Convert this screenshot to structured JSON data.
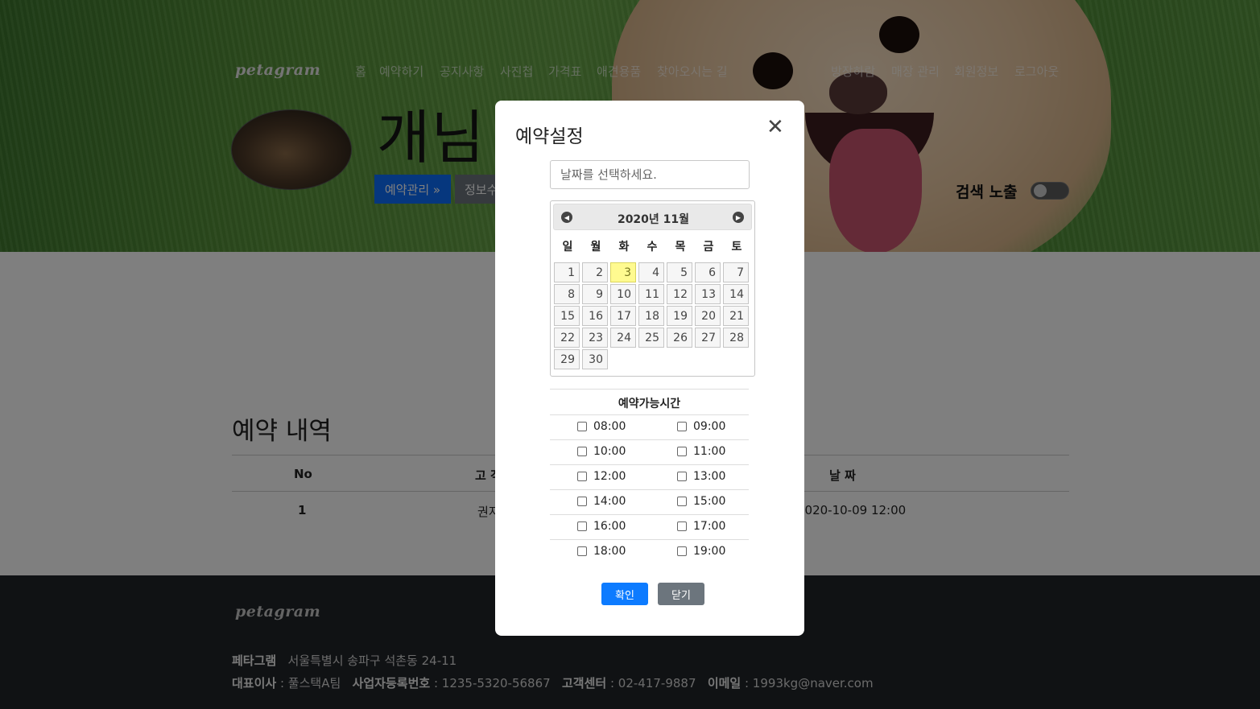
{
  "brand": {
    "logo": "petagram"
  },
  "nav": {
    "items": [
      "홈",
      "예약하기",
      "공지사항",
      "사진첩",
      "가격표",
      "애견용품",
      "찾아오시는 길"
    ],
    "right_items": [
      "방장하람",
      "매장 관리",
      "회원정보",
      "로그아웃"
    ]
  },
  "shop": {
    "name": "개님",
    "manage_button": "예약관리 »",
    "info_button": "정보수",
    "search_expose_label": "검색 노출"
  },
  "reservations": {
    "title": "예약 내역",
    "columns": [
      "No",
      "고 객",
      "날 짜"
    ],
    "rows": [
      {
        "no": "1",
        "customer": "권지",
        "date": "2020-10-09 12:00"
      }
    ]
  },
  "footer": {
    "logo": "petagram",
    "company_label": "페타그램",
    "address": "서울특별시 송파구 석촌동 24-11",
    "ceo_label": "대표이사",
    "ceo_value": " : 풀스택A팀",
    "biz_label": "사업자등록번호",
    "biz_value": " : 1235-5320-56867",
    "cs_label": "고객센터",
    "cs_value": " : 02-417-9887",
    "email_label": "이메일",
    "email_value": " : 1993kg@naver.com"
  },
  "modal": {
    "title": "예약설정",
    "close_icon": "close-icon",
    "date_placeholder": "날짜를 선택하세요.",
    "calendar": {
      "title": "2020년 11월",
      "weekdays": [
        "일",
        "월",
        "화",
        "수",
        "목",
        "금",
        "토"
      ],
      "days": [
        1,
        2,
        3,
        4,
        5,
        6,
        7,
        8,
        9,
        10,
        11,
        12,
        13,
        14,
        15,
        16,
        17,
        18,
        19,
        20,
        21,
        22,
        23,
        24,
        25,
        26,
        27,
        28,
        29,
        30
      ],
      "first_weekday_index": 0,
      "highlighted_day": 3,
      "highlight_color": "#fffa90"
    },
    "time_title": "예약가능시간",
    "times": [
      "08:00",
      "09:00",
      "10:00",
      "11:00",
      "12:00",
      "13:00",
      "14:00",
      "15:00",
      "16:00",
      "17:00",
      "18:00",
      "19:00"
    ],
    "confirm_label": "확인",
    "close_label": "닫기"
  },
  "colors": {
    "primary": "#0d7bff",
    "secondary": "#6c757d",
    "footer_bg": "#212529"
  }
}
